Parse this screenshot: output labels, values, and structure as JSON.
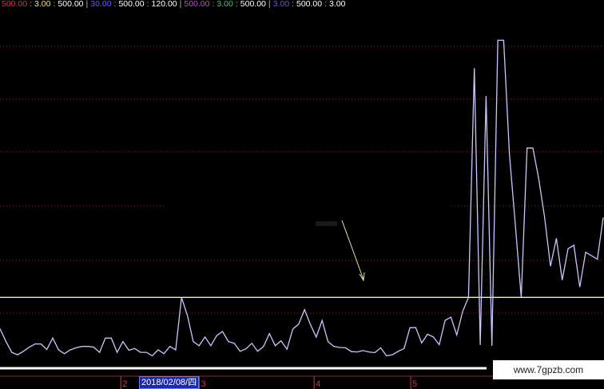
{
  "legend": {
    "g1": [
      "500.00",
      "3.00",
      "500.00"
    ],
    "g2": [
      "30.00",
      "500.00",
      "120.00"
    ],
    "g3": [
      "500.00",
      "3.00",
      "500.00"
    ],
    "g4": [
      "3.00",
      "500.00",
      "3.00"
    ]
  },
  "colors": {
    "background": "#000000",
    "series": "#c8c8ff",
    "hline": "#f0f0c8",
    "arrow": "#e8e8a0",
    "grid": "#8c2a2a",
    "axis_label": "#e0304a",
    "date_highlight": "#1c2aa8"
  },
  "cursor_date": "2018/02/08/四",
  "watermark": "www.7gpzb.com",
  "chart_data": {
    "type": "line",
    "title": "",
    "xlabel": "",
    "ylabel": "",
    "x_ticks": [
      "2",
      "3",
      "4",
      "5"
    ],
    "x_tick_positions": [
      20,
      33,
      52,
      68
    ],
    "xlim": [
      0,
      100
    ],
    "ylim": [
      0,
      100
    ],
    "grid": true,
    "horizontal_line": 19,
    "series": [
      {
        "values": [
          10,
          6.4,
          3.2,
          2.5,
          3.5,
          4.7,
          5.6,
          5.6,
          4,
          7.3,
          3.9,
          2.8,
          3.9,
          4.5,
          4.9,
          4.9,
          4.7,
          3.2,
          7.3,
          7.3,
          3.2,
          6.3,
          3.8,
          4.3,
          3.2,
          3.2,
          2.2,
          3.9,
          2.8,
          4.9,
          3.9,
          19,
          13.8,
          6.3,
          5.1,
          7.6,
          5.1,
          8,
          9.2,
          6.3,
          5.8,
          3.5,
          4.2,
          5.8,
          3.5,
          4.9,
          8.6,
          5.1,
          6.5,
          4.1,
          9.9,
          11.3,
          15.5,
          11.2,
          7.6,
          12.4,
          6.3,
          4.9,
          4.6,
          4.5,
          3.4,
          3.3,
          3.7,
          3.3,
          3.1,
          4.5,
          2.2,
          2.5,
          3.5,
          4.3,
          10.3,
          10.3,
          5.9,
          8.4,
          7.6,
          5.4,
          12.4,
          13.3,
          8.2,
          15,
          19,
          85,
          5.3,
          77,
          5.1,
          93,
          93,
          60,
          40,
          19,
          62,
          62,
          53,
          42,
          28,
          36,
          24,
          33,
          34,
          22,
          32,
          31,
          30,
          42
        ]
      }
    ]
  }
}
